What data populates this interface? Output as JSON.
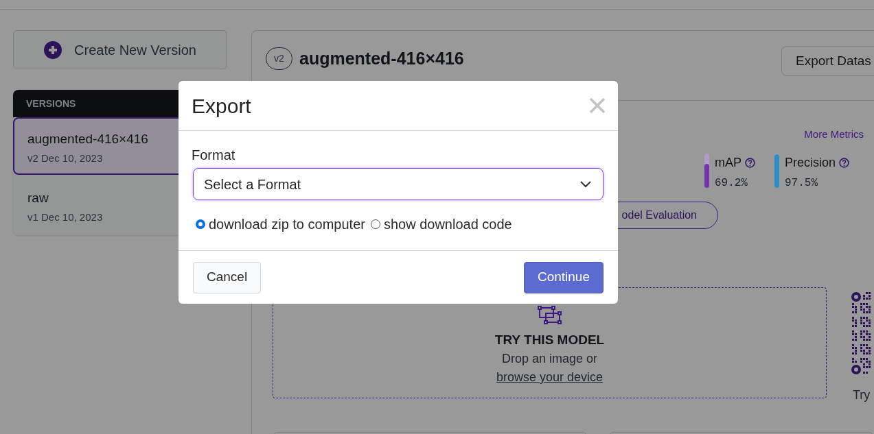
{
  "sidebar": {
    "create_button": "Create New Version",
    "versions_heading": "VERSIONS",
    "versions": [
      {
        "name": "augmented-416×416",
        "meta": "v2 Dec 10, 2023",
        "selected": true
      },
      {
        "name": "raw",
        "meta": "v1 Dec 10, 2023",
        "selected": false
      }
    ]
  },
  "version": {
    "badge": "v2",
    "title": "augmented-416×416",
    "export_button": "Export Datas"
  },
  "metrics": {
    "link": "More Metrics",
    "items": [
      {
        "label": "mAP",
        "value": "69.2%",
        "level": 0.692,
        "color": "#7433b3"
      },
      {
        "label": "Precision",
        "value": "97.5%",
        "level": 0.975,
        "color": "#2b8ec4"
      }
    ],
    "evaluation_button": "odel Evaluation"
  },
  "try_model": {
    "title": "TRY THIS MODEL",
    "text": "Drop an image or",
    "link": "browse your device",
    "side_caption": "Try"
  },
  "dialog": {
    "title": "Export",
    "field_label": "Format",
    "select_placeholder": "Select a Format",
    "options": [
      {
        "label": "download zip to computer",
        "selected": true
      },
      {
        "label": "show download code",
        "selected": false
      }
    ],
    "buttons": [
      {
        "label": "Cancel",
        "kind": "secondary"
      },
      {
        "label": "Continue",
        "kind": "primary"
      }
    ]
  }
}
